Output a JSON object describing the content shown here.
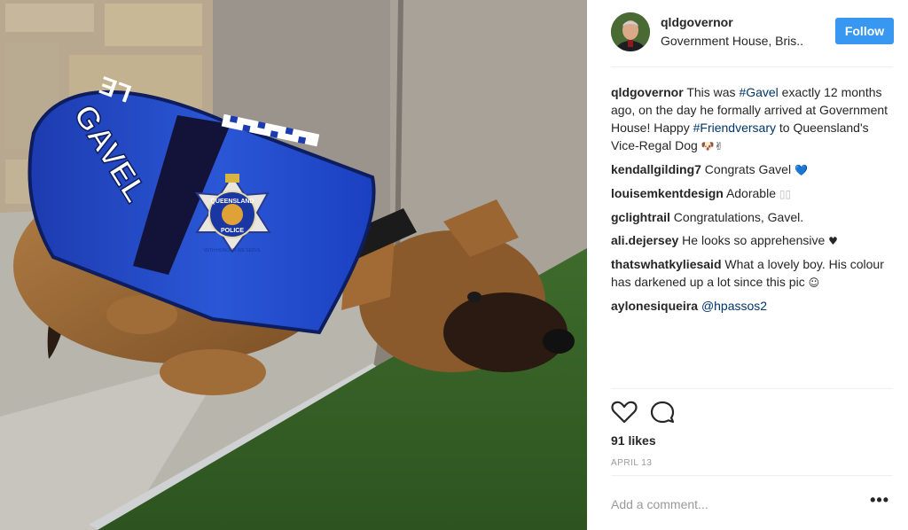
{
  "photo": {
    "vest_name": "GAVEL",
    "vest_top_text": "LE",
    "badge_line1": "QUEENSLAND",
    "badge_line2": "POLICE",
    "badge_motto": "WITH HONOUR WE SERVE"
  },
  "header": {
    "username": "qldgovernor",
    "location": "Government House, Bris..",
    "follow_label": "Follow"
  },
  "caption": {
    "username": "qldgovernor",
    "text_1": "This was ",
    "tag_1": "#Gavel",
    "text_2": " exactly 12 months ago, on the day he formally arrived at Government House! Happy ",
    "tag_2": "#Friendversary",
    "text_3": " to Queensland's Vice-Regal Dog ",
    "emoji": "🐶✌"
  },
  "comments": [
    {
      "username": "kendallgilding7",
      "text": "Congrats Gavel ",
      "emoji": "💙"
    },
    {
      "username": "louisemkentdesign",
      "text": "Adorable ",
      "emoji": "▯▯"
    },
    {
      "username": "gclightrail",
      "text": "Congratulations, Gavel.",
      "emoji": ""
    },
    {
      "username": "ali.dejersey",
      "text": "He looks so apprehensive ",
      "emoji": "♥"
    },
    {
      "username": "thatswhatkyliesaid",
      "text": "What a lovely boy. His colour has darkened up a lot since this pic ",
      "emoji": "☺"
    },
    {
      "username": "aylonesiqueira",
      "text": "",
      "mention": "@hpassos2"
    }
  ],
  "actions": {
    "likes": "91 likes",
    "date": "APRIL 13",
    "like_icon": "heart-icon",
    "comment_icon": "comment-icon"
  },
  "add_comment": {
    "placeholder": "Add a comment...",
    "more_label": "•••"
  },
  "colors": {
    "follow_bg": "#3897f0",
    "hashtag": "#003569",
    "divider": "#efefef",
    "muted": "#999999"
  }
}
